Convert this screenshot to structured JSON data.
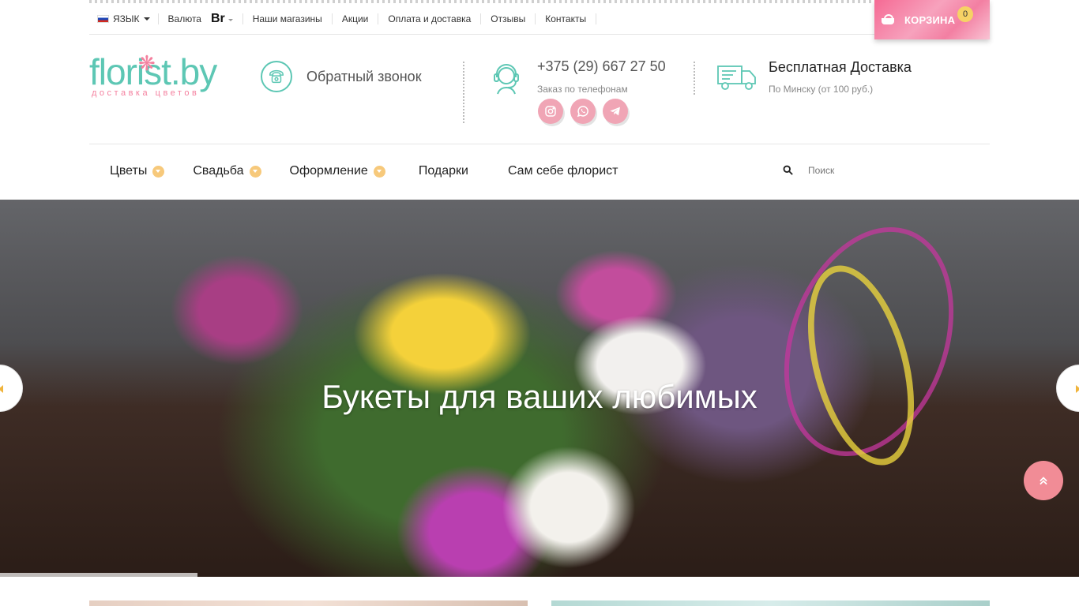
{
  "topbar": {
    "language_label": "ЯЗЫК",
    "currency_label": "Валюта",
    "currency_value": "Br",
    "links": [
      "Наши магазины",
      "Акции",
      "Оплата и доставка",
      "Отзывы",
      "Контакты"
    ]
  },
  "cart": {
    "label": "КОРЗИНА",
    "count": "0"
  },
  "logo": {
    "name": "florist.by",
    "tagline": "доставка цветов"
  },
  "callback": {
    "label": "Обратный звонок"
  },
  "phone": {
    "number": "+375 (29) 667 27 50",
    "caption": "Заказ по телефонам"
  },
  "socials": [
    "instagram-icon",
    "whatsapp-icon",
    "telegram-icon"
  ],
  "delivery": {
    "title": "Бесплатная Доставка",
    "subtitle": "По Минску (от 100 руб.)"
  },
  "nav": {
    "items": [
      {
        "label": "Цветы",
        "has_dropdown": true
      },
      {
        "label": "Свадьба",
        "has_dropdown": true
      },
      {
        "label": "Оформление",
        "has_dropdown": true
      },
      {
        "label": "Подарки",
        "has_dropdown": false
      },
      {
        "label": "Сам себе флорист",
        "has_dropdown": false
      }
    ],
    "search_placeholder": "Поиск"
  },
  "hero": {
    "title": "Букеты для ваших любимых"
  },
  "colors": {
    "accent_teal": "#5dc7b4",
    "accent_pink": "#f4819f",
    "social_pink": "#f0a5b5",
    "nav_dot": "#f7c97b",
    "scroll_top": "#f18c96"
  }
}
